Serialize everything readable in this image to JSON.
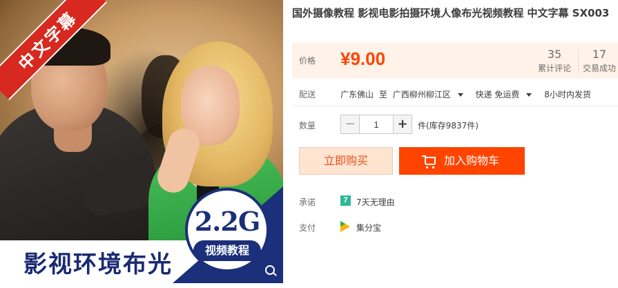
{
  "image": {
    "ribbon_text": "中文字幕",
    "banner_text": "影视环境布光",
    "badge_size": "2.2G",
    "badge_label": "视频教程"
  },
  "product": {
    "title": "国外摄像教程 影视电影拍摄环境人像布光视频教程 中文字幕 SX003"
  },
  "price": {
    "label": "价格",
    "value": "¥9.00",
    "reviews_count": "35",
    "reviews_label": "累计评论",
    "sales_count": "17",
    "sales_label": "交易成功"
  },
  "shipping": {
    "label": "配送",
    "from": "广东佛山",
    "to_word": "至",
    "destination": "广西柳州柳江区",
    "method": "快递 免运费",
    "dispatch": "8小时内发货"
  },
  "quantity": {
    "label": "数量",
    "minus": "−",
    "value": "1",
    "plus": "+",
    "stock": "件(库存9837件)"
  },
  "actions": {
    "buy_now": "立即购买",
    "add_to_cart": "加入购物车"
  },
  "promise": {
    "label": "承诺",
    "icon_text": "7",
    "text": "7天无理由"
  },
  "payment": {
    "label": "支付",
    "text": "集分宝"
  },
  "colors": {
    "accent": "#ff4400",
    "price_bg": "#fff2e8",
    "ribbon": "#d7291f",
    "banner_navy": "#1b2f7a",
    "promise_green": "#2eb89a"
  },
  "icons": [
    "cart-icon",
    "zoom-icon",
    "promise-7-icon",
    "jifenbao-icon",
    "caret-down-icon"
  ]
}
